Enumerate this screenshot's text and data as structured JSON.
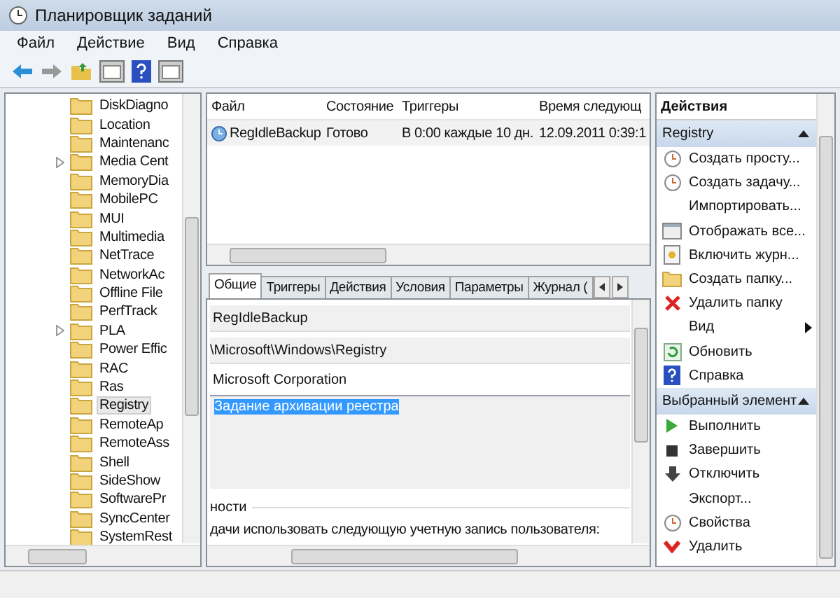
{
  "window": {
    "title": "Планировщик заданий"
  },
  "menu": [
    "Файл",
    "Действие",
    "Вид",
    "Справка"
  ],
  "tree": {
    "items": [
      {
        "label": "DiskDiagno",
        "expandable": false,
        "selected": false
      },
      {
        "label": "Location",
        "expandable": false,
        "selected": false
      },
      {
        "label": "Maintenanc",
        "expandable": false,
        "selected": false
      },
      {
        "label": "Media Cent",
        "expandable": true,
        "selected": false
      },
      {
        "label": "MemoryDia",
        "expandable": false,
        "selected": false
      },
      {
        "label": "MobilePC",
        "expandable": false,
        "selected": false
      },
      {
        "label": "MUI",
        "expandable": false,
        "selected": false
      },
      {
        "label": "Multimedia",
        "expandable": false,
        "selected": false
      },
      {
        "label": "NetTrace",
        "expandable": false,
        "selected": false
      },
      {
        "label": "NetworkAc",
        "expandable": false,
        "selected": false
      },
      {
        "label": "Offline File",
        "expandable": false,
        "selected": false
      },
      {
        "label": "PerfTrack",
        "expandable": false,
        "selected": false
      },
      {
        "label": "PLA",
        "expandable": true,
        "selected": false
      },
      {
        "label": "Power Effic",
        "expandable": false,
        "selected": false
      },
      {
        "label": "RAC",
        "expandable": false,
        "selected": false
      },
      {
        "label": "Ras",
        "expandable": false,
        "selected": false
      },
      {
        "label": "Registry",
        "expandable": false,
        "selected": true
      },
      {
        "label": "RemoteAp",
        "expandable": false,
        "selected": false
      },
      {
        "label": "RemoteAss",
        "expandable": false,
        "selected": false
      },
      {
        "label": "Shell",
        "expandable": false,
        "selected": false
      },
      {
        "label": "SideShow",
        "expandable": false,
        "selected": false
      },
      {
        "label": "SoftwarePr",
        "expandable": false,
        "selected": false
      },
      {
        "label": "SyncCenter",
        "expandable": false,
        "selected": false
      },
      {
        "label": "SystemRest",
        "expandable": false,
        "selected": false
      }
    ]
  },
  "task_list": {
    "columns": [
      "Файл",
      "Состояние",
      "Триггеры",
      "Время следующ"
    ],
    "rows": [
      {
        "cells": [
          "RegIdleBackup",
          "Готово",
          "В 0:00 каждые 10 дн.",
          "12.09.2011 0:39:1"
        ],
        "selected": false
      }
    ]
  },
  "detail_tabs": [
    {
      "label": "Общие",
      "selected": true
    },
    {
      "label": "Триггеры",
      "selected": false
    },
    {
      "label": "Действия",
      "selected": false
    },
    {
      "label": "Условия",
      "selected": false
    },
    {
      "label": "Параметры",
      "selected": false
    },
    {
      "label": "Журнал (",
      "selected": false
    }
  ],
  "details": {
    "name": "RegIdleBackup",
    "location": "\\Microsoft\\Windows\\Registry",
    "author": "Microsoft Corporation",
    "description": "Задание архивации реестра",
    "security_heading": "ности",
    "security_text": "дачи использовать следующую учетную запись пользователя:"
  },
  "actions": {
    "title": "Действия",
    "sections": [
      {
        "title": "Registry",
        "expanded": true,
        "items": [
          {
            "label": "Создать просту...",
            "kind": "item"
          },
          {
            "label": "Создать задачу...",
            "kind": "item"
          },
          {
            "label": "Импортировать...",
            "kind": "item"
          },
          {
            "label": "Отображать все...",
            "kind": "item"
          },
          {
            "label": "Включить журн...",
            "kind": "item"
          },
          {
            "label": "Создать папку...",
            "kind": "item"
          },
          {
            "label": "Удалить папку",
            "kind": "item"
          },
          {
            "label": "Вид",
            "kind": "submenu"
          },
          {
            "label": "Обновить",
            "kind": "item"
          },
          {
            "label": "Справка",
            "kind": "item"
          }
        ]
      },
      {
        "title": "Выбранный элемент",
        "expanded": true,
        "items": [
          {
            "label": "Выполнить",
            "kind": "item"
          },
          {
            "label": "Завершить",
            "kind": "item"
          },
          {
            "label": "Отключить",
            "kind": "item"
          },
          {
            "label": "Экспорт...",
            "kind": "item"
          },
          {
            "label": "Свойства",
            "kind": "item"
          },
          {
            "label": "Удалить",
            "kind": "item"
          }
        ]
      }
    ]
  }
}
